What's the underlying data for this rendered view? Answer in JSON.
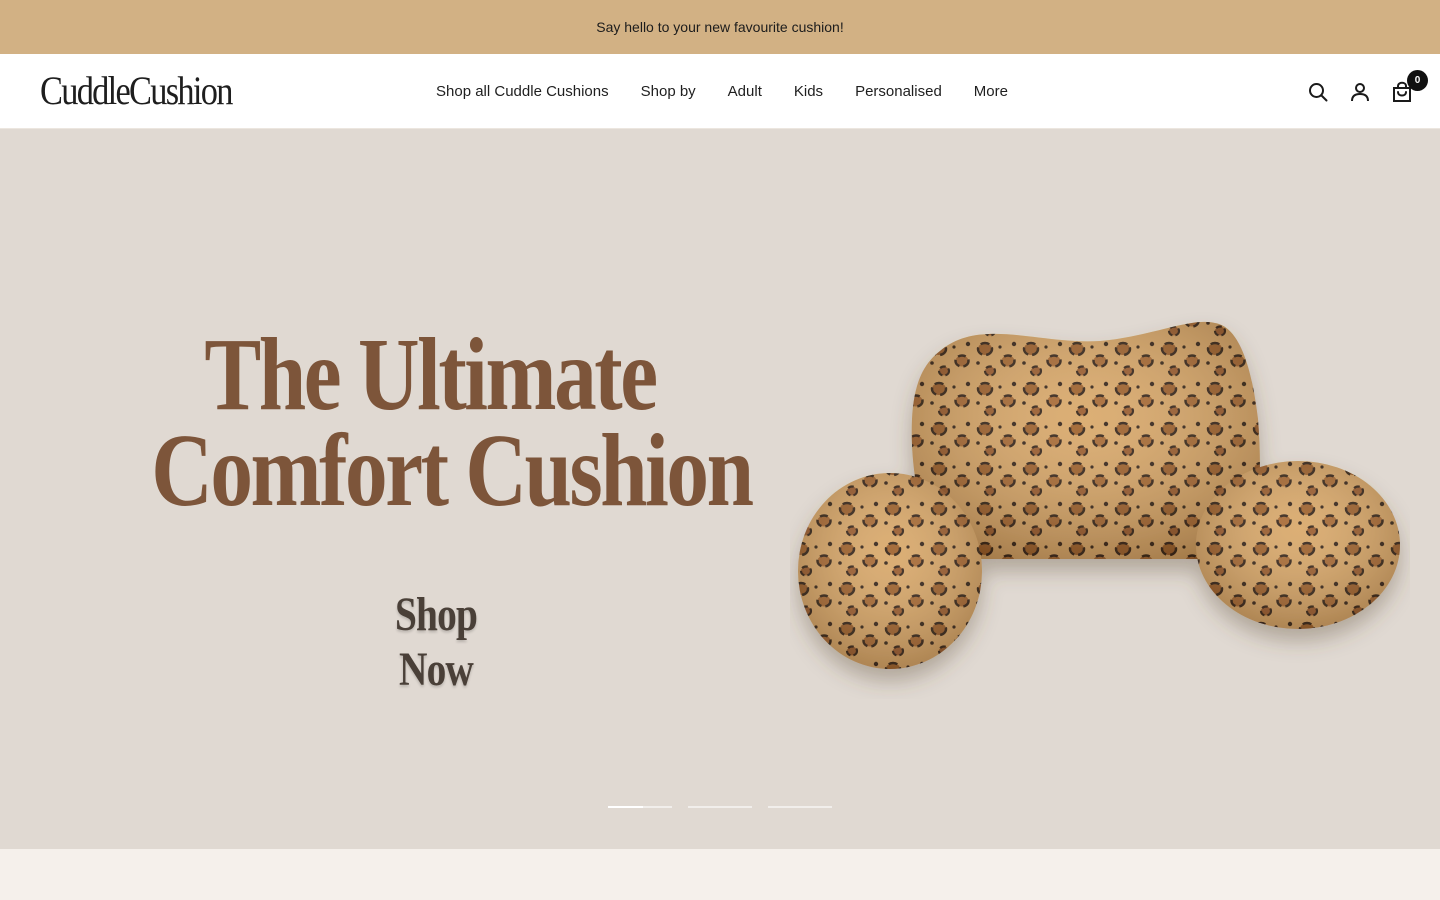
{
  "announcement": {
    "text": "Say hello to your new favourite cushion!"
  },
  "header": {
    "logo_text": "CuddleCushion",
    "nav": [
      {
        "label": "Shop all Cuddle Cushions"
      },
      {
        "label": "Shop by"
      },
      {
        "label": "Adult"
      },
      {
        "label": "Kids"
      },
      {
        "label": "Personalised"
      },
      {
        "label": "More"
      }
    ],
    "icons": {
      "search": "search-icon",
      "account": "account-icon",
      "cart": "cart-icon"
    },
    "cart_count": "0"
  },
  "hero": {
    "headline_line1": "The Ultimate",
    "headline_line2": "Comfort Cushion",
    "cta_label": "Shop Now",
    "image_subject": "leopard-print-reading-pillow",
    "slides_total": 3,
    "active_slide": 1,
    "active_slide_progress": 0.55
  },
  "colors": {
    "announcement_bg": "#d2b184",
    "hero_bg": "#e0d9d2",
    "headline": "#7d553a",
    "page_bg": "#f5f0eb"
  }
}
